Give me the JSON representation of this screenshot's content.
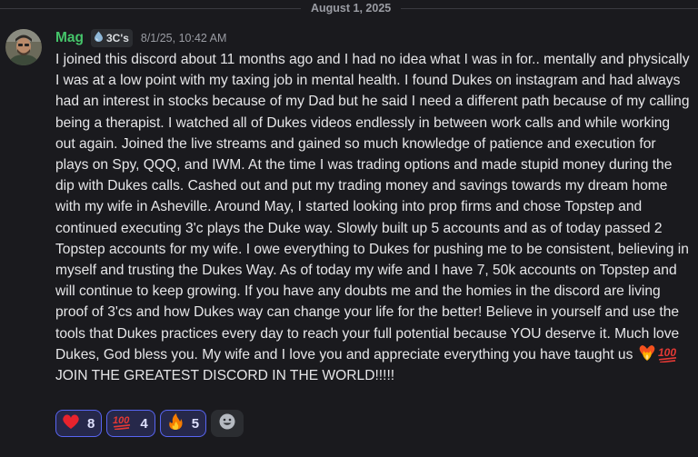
{
  "date_divider": "August 1, 2025",
  "message": {
    "author": "Mag",
    "author_color": "#45c46a",
    "tag": {
      "icon": "drop-icon",
      "label": "3C's"
    },
    "timestamp": "8/1/25, 10:42 AM",
    "text": "I joined this discord about 11 months ago and I had no idea what I was in for.. mentally and physically I was at a low point with my taxing job in mental health. I found Dukes on instagram and had always had an interest in stocks because of my Dad but he said I need a different path because of my calling being a therapist. I watched all of Dukes videos endlessly in between work calls and while working out again. Joined the live streams and gained so much knowledge of patience and execution for plays on Spy, QQQ, and IWM. At the time I was trading options and made stupid money during the dip with Dukes calls. Cashed out and put my trading money and savings towards my dream home with my wife in Asheville. Around May, I started looking into prop firms and chose Topstep and continued executing 3'c plays the Duke way. Slowly built up 5 accounts and as of today passed 2 Topstep accounts for my wife. I owe everything to Dukes for pushing me to be consistent, believing in myself and trusting the Dukes Way. As of today my wife and I have 7, 50k accounts on Topstep and will continue to keep growing. If you have any doubts me and the homies in the discord are living proof of 3'cs and how Dukes way can change your life for the better! Believe in yourself and use the tools that Dukes practices every day to reach your full potential because YOU deserve it. Much love Dukes, God bless you. My wife and I love you and appreciate everything you have taught us",
    "emojis": [
      "heart-on-fire-emoji",
      "hundred-points-emoji"
    ],
    "text_tail": " JOIN THE GREATEST DISCORD IN THE WORLD!!!!!"
  },
  "reactions": [
    {
      "emoji": "red-heart-emoji",
      "count": "8"
    },
    {
      "emoji": "hundred-points-emoji",
      "count": "4"
    },
    {
      "emoji": "fire-emoji",
      "count": "5"
    }
  ],
  "add_reaction_icon": "smiley-add-reaction-icon",
  "colors": {
    "background": "#1a1a1e",
    "reaction_border": "#5865f2",
    "reaction_bg": "#26284a"
  }
}
